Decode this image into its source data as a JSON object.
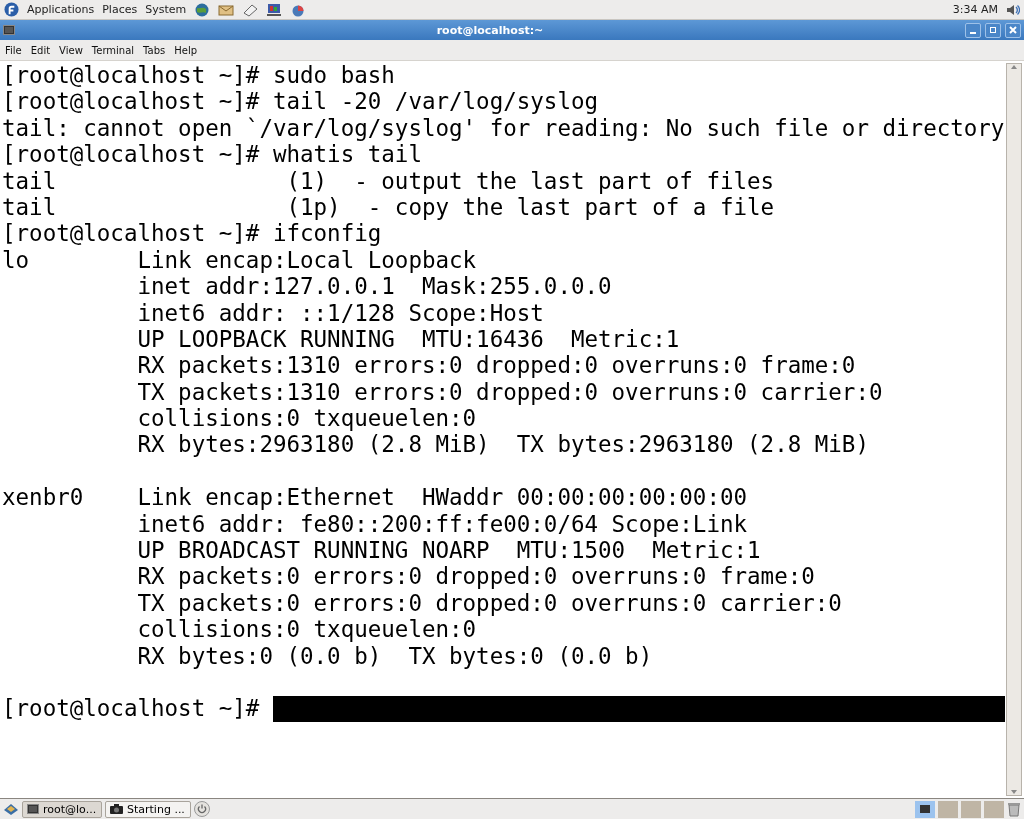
{
  "top_panel": {
    "menus": [
      "Applications",
      "Places",
      "System"
    ],
    "clock": "3:34 AM"
  },
  "window": {
    "title": "root@localhost:~"
  },
  "menu_bar": [
    "File",
    "Edit",
    "View",
    "Terminal",
    "Tabs",
    "Help"
  ],
  "terminal": {
    "blocks": [
      [
        "[root@localhost ~]# sudo bash",
        "[root@localhost ~]# tail -20 /var/log/syslog",
        "tail: cannot open `/var/log/syslog' for reading: No such file or directory",
        "[root@localhost ~]# whatis tail",
        "tail                 (1)  - output the last part of files",
        "tail                 (1p)  - copy the last part of a file",
        "[root@localhost ~]# ifconfig",
        "lo        Link encap:Local Loopback",
        "          inet addr:127.0.0.1  Mask:255.0.0.0",
        "          inet6 addr: ::1/128 Scope:Host",
        "          UP LOOPBACK RUNNING  MTU:16436  Metric:1",
        "          RX packets:1310 errors:0 dropped:0 overruns:0 frame:0",
        "          TX packets:1310 errors:0 dropped:0 overruns:0 carrier:0",
        "          collisions:0 txqueuelen:0",
        "          RX bytes:2963180 (2.8 MiB)  TX bytes:2963180 (2.8 MiB)"
      ],
      [
        "xenbr0    Link encap:Ethernet  HWaddr 00:00:00:00:00:00",
        "          inet6 addr: fe80::200:ff:fe00:0/64 Scope:Link",
        "          UP BROADCAST RUNNING NOARP  MTU:1500  Metric:1",
        "          RX packets:0 errors:0 dropped:0 overruns:0 frame:0",
        "          TX packets:0 errors:0 dropped:0 overruns:0 carrier:0",
        "          collisions:0 txqueuelen:0",
        "          RX bytes:0 (0.0 b)  TX bytes:0 (0.0 b)"
      ]
    ],
    "prompt": "[root@localhost ~]# "
  },
  "taskbar": {
    "tasks": [
      {
        "label": "root@lo...",
        "selected": true
      },
      {
        "label": "Starting ...",
        "selected": false
      }
    ],
    "workspaces": [
      {
        "selected": true
      },
      {
        "selected": false
      },
      {
        "selected": false
      },
      {
        "selected": false
      }
    ]
  }
}
